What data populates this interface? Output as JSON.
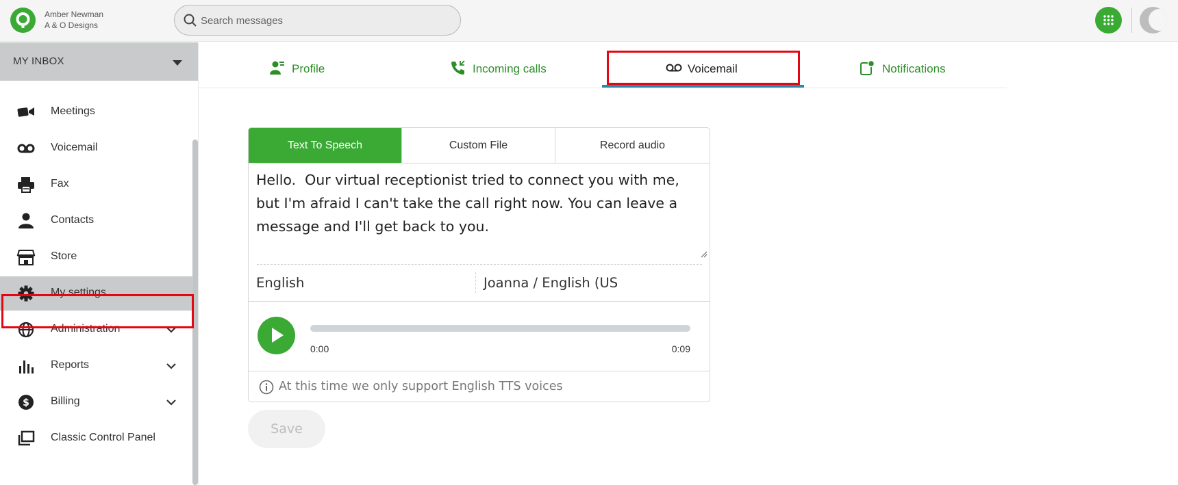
{
  "header": {
    "user_name": "Amber Newman",
    "company": "A & O Designs",
    "search_placeholder": "Search messages",
    "logo_icon": "phone-pin-logo",
    "apps_icon": "grid-icon",
    "avatar_icon": "moon-avatar"
  },
  "sidebar": {
    "inbox_label": "MY INBOX",
    "items": [
      {
        "label": "Meetings",
        "icon": "video-camera-icon"
      },
      {
        "label": "Voicemail",
        "icon": "voicemail-icon"
      },
      {
        "label": "Fax",
        "icon": "fax-icon"
      },
      {
        "label": "Contacts",
        "icon": "person-icon"
      },
      {
        "label": "Store",
        "icon": "store-icon"
      },
      {
        "label": "My settings",
        "icon": "gear-icon",
        "active": true
      },
      {
        "label": "Administration",
        "icon": "globe-icon",
        "expandable": true
      },
      {
        "label": "Reports",
        "icon": "bar-chart-icon",
        "expandable": true
      },
      {
        "label": "Billing",
        "icon": "dollar-icon",
        "expandable": true
      },
      {
        "label": "Classic Control Panel",
        "icon": "windows-icon"
      }
    ]
  },
  "tabs": [
    {
      "label": "Profile",
      "icon": "profile-icon"
    },
    {
      "label": "Incoming calls",
      "icon": "incoming-call-icon"
    },
    {
      "label": "Voicemail",
      "icon": "voicemail-icon",
      "active": true
    },
    {
      "label": "Notifications",
      "icon": "notification-icon"
    }
  ],
  "greeting": {
    "modes": [
      "Text To Speech",
      "Custom File",
      "Record audio"
    ],
    "active_mode": "Text To Speech",
    "text": "Hello.  Our virtual receptionist tried to connect you with me, but I'm afraid I can't take the call right now. You can leave a message and I'll get back to you.",
    "language": "English",
    "voice": "Joanna / English (US",
    "player": {
      "current_time": "0:00",
      "duration": "0:09",
      "progress": 0
    },
    "info_text": "At this time we only support English TTS voices",
    "save_label": "Save"
  },
  "colors": {
    "brand_green": "#3aaa35",
    "highlight_red": "#e30613",
    "tab_underline": "#2e86ae"
  }
}
